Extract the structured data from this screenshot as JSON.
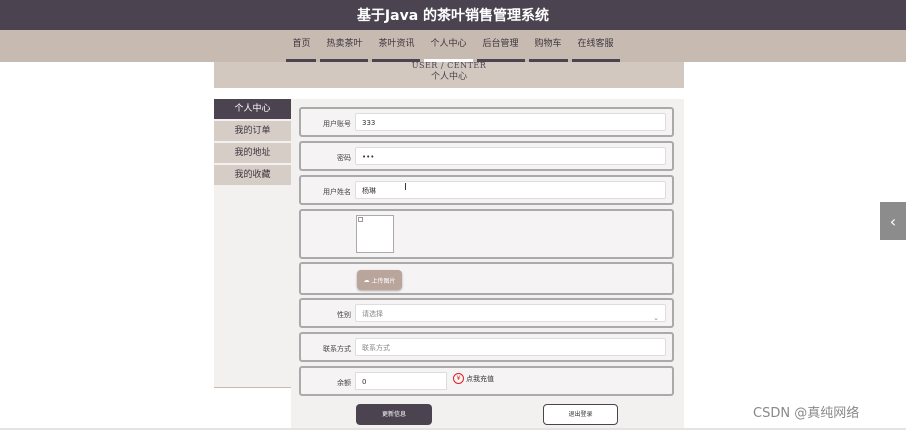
{
  "header": {
    "title": "基于Java 的茶叶销售管理系统"
  },
  "nav": {
    "items": [
      "首页",
      "热卖茶叶",
      "茶叶资讯",
      "个人中心",
      "后台管理",
      "购物车",
      "在线客服"
    ],
    "active_index": 3
  },
  "banner": {
    "en": "USER / CENTER",
    "zh": "个人中心"
  },
  "sidebar": {
    "items": [
      "个人中心",
      "我的订单",
      "我的地址",
      "我的收藏"
    ],
    "active_index": 0
  },
  "form": {
    "account": {
      "label": "用户账号",
      "value": "333"
    },
    "password": {
      "label": "密码",
      "value": "•••"
    },
    "name": {
      "label": "用户姓名",
      "value": "杨琳"
    },
    "upload_label": "上传图片",
    "gender": {
      "label": "性别",
      "placeholder": "请选择"
    },
    "contact": {
      "label": "联系方式",
      "placeholder": "联系方式"
    },
    "balance": {
      "label": "余额",
      "value": "0",
      "recharge_label": "点我充值"
    }
  },
  "buttons": {
    "update": "更新信息",
    "logout": "退出登录"
  },
  "watermark": "CSDN @真纯网络",
  "icons": {
    "cloud": "cloud-upload-icon",
    "chevron": "chevron-down-icon",
    "left": "chevron-left-icon",
    "yen": "yen-circle-icon"
  },
  "colors": {
    "primary": "#4b4350",
    "nav_bg": "#c7bab1",
    "accent": "#b9a59c"
  }
}
